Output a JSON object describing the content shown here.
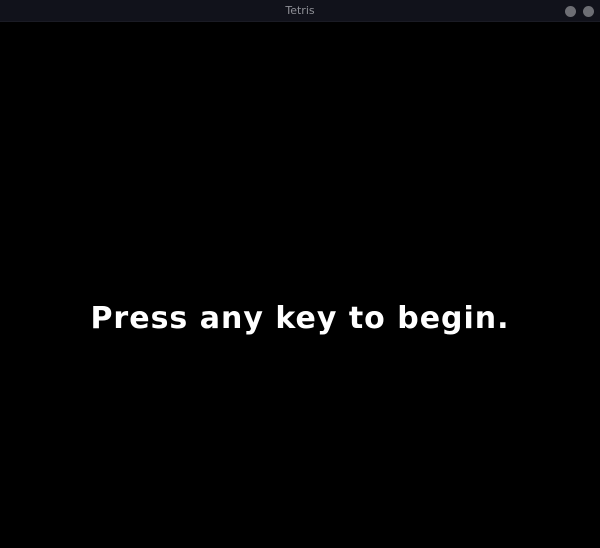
{
  "window": {
    "title": "Tetris",
    "controls": [
      {
        "name": "minimize",
        "icon": "circle-icon",
        "color": "#6d6e74"
      },
      {
        "name": "close",
        "icon": "circle-icon",
        "color": "#6d6e74"
      }
    ]
  },
  "game": {
    "background_color": "#000000",
    "text_color": "#ffffff",
    "start_prompt": "Press any key to begin."
  }
}
